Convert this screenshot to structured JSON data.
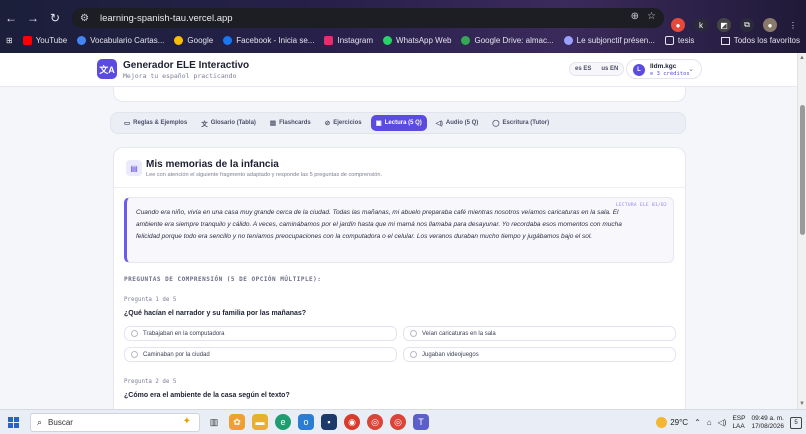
{
  "browser": {
    "url": "learning-spanish-tau.vercel.app",
    "bookmarks": [
      {
        "label": "YouTube",
        "color": "#ff0000"
      },
      {
        "label": "Vocabulario Cartas...",
        "color": "#4285f4"
      },
      {
        "label": "Google",
        "color": "#fbbc05"
      },
      {
        "label": "Facebook - Inicia se...",
        "color": "#1877f2"
      },
      {
        "label": "Instagram",
        "color": "#e1306c"
      },
      {
        "label": "WhatsApp Web",
        "color": "#25d366"
      },
      {
        "label": "Google Drive: almac...",
        "color": "#34a853"
      },
      {
        "label": "Le subjonctif présen...",
        "color": "#9aa0ff"
      },
      {
        "label": "tesis",
        "color": "#e8c25a"
      }
    ],
    "bookmarks_all": "Todos los favoritos"
  },
  "app": {
    "logo": "文A",
    "title": "Generador ELE Interactivo",
    "subtitle": "Mejora tu español practicando",
    "lang_es": "ES",
    "lang_en": "EN",
    "user_initial": "L",
    "user_name": "lldm.kgc",
    "user_credits": "3 créditos"
  },
  "tabs": [
    {
      "icon": "book-icon",
      "label": "Reglas & Ejemplos",
      "active": false
    },
    {
      "icon": "translate-icon",
      "label": "Glosario (Tabla)",
      "active": false
    },
    {
      "icon": "cards-icon",
      "label": "Flashcards",
      "active": false
    },
    {
      "icon": "check-circle-icon",
      "label": "Ejercicios",
      "active": false
    },
    {
      "icon": "reading-icon",
      "label": "Lectura (5 Q)",
      "active": true
    },
    {
      "icon": "audio-icon",
      "label": "Audio (5 Q)",
      "active": false
    },
    {
      "icon": "chat-icon",
      "label": "Escritura (Tutor)",
      "active": false
    }
  ],
  "section": {
    "title": "Mis memorias de la infancia",
    "subtitle": "Lee con atención el siguiente fragmento adaptado y responde las 5 preguntas de comprensión.",
    "reading_tag": "LECTURA ELE B1/B2",
    "reading_text": "Cuando era niño, vivía en una casa muy grande cerca de la ciudad. Todas las mañanas, mi abuelo preparaba café mientras nosotros veíamos caricaturas en la sala. El ambiente era siempre tranquilo y cálido. A veces, caminábamos por el jardín hasta que mi mamá nos llamaba para desayunar. Yo recordaba esos momentos con mucha felicidad porque todo era sencillo y no teníamos preocupaciones con la computadora o el celular. Los veranos duraban mucho tiempo y jugábamos bajo el sol.",
    "questions_heading": "PREGUNTAS DE COMPRENSIÓN (5 DE OPCIÓN MÚLTIPLE):"
  },
  "questions": [
    {
      "number": "Pregunta 1 de 5",
      "text": "¿Qué hacían el narrador y su familia por las mañanas?",
      "options": [
        "Trabajaban en la computadora",
        "Veían caricaturas en la sala",
        "Caminaban por la ciudad",
        "Jugaban videojuegos"
      ]
    },
    {
      "number": "Pregunta 2 de 5",
      "text": "¿Cómo era el ambiente de la casa según el texto?",
      "options": []
    }
  ],
  "taskbar": {
    "search_placeholder": "Buscar",
    "weather_temp": "29°C",
    "notif_count": "5",
    "lang_1": "ESP",
    "lang_2": "LAA",
    "time": "09:49 a. m.",
    "date": "17/08/2026"
  }
}
